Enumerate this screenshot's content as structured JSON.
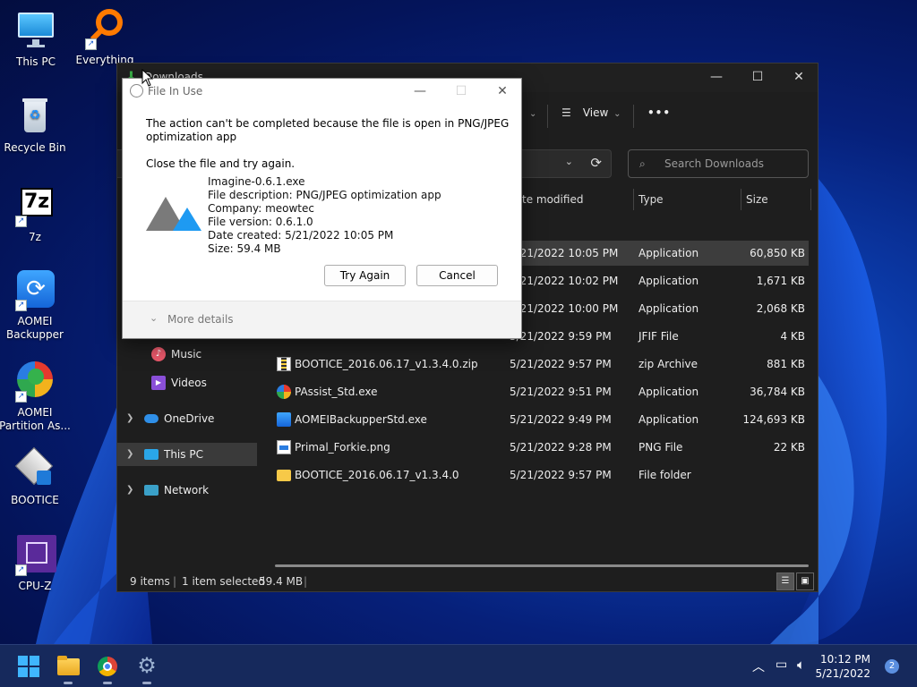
{
  "desktop": {
    "icons": [
      {
        "label": "This PC"
      },
      {
        "label": "Everything"
      },
      {
        "label": "Recycle Bin"
      },
      {
        "label": "7z"
      },
      {
        "label": "AOMEI Backupper"
      },
      {
        "label": "AOMEI Partition As..."
      },
      {
        "label": "BOOTICE"
      },
      {
        "label": "CPU-Z"
      }
    ]
  },
  "explorer": {
    "title": "Downloads",
    "toolbar": {
      "view_label": "View",
      "more_label": "•••"
    },
    "search_placeholder": "Search Downloads",
    "columns": {
      "date": "te modified",
      "type": "Type",
      "size": "Size"
    },
    "nav": [
      {
        "label": "Music"
      },
      {
        "label": "Videos"
      },
      {
        "label": "OneDrive"
      },
      {
        "label": "This PC"
      },
      {
        "label": "Network"
      }
    ],
    "files": [
      {
        "name": "",
        "date": "5/21/2022 10:05 PM",
        "type": "Application",
        "size": "60,850 KB"
      },
      {
        "name": "",
        "date": "5/21/2022 10:02 PM",
        "type": "Application",
        "size": "1,671 KB"
      },
      {
        "name": "",
        "date": "5/21/2022 10:00 PM",
        "type": "Application",
        "size": "2,068 KB"
      },
      {
        "name": "",
        "date": "5/21/2022 9:59 PM",
        "type": "JFIF File",
        "size": "4 KB"
      },
      {
        "name": "BOOTICE_2016.06.17_v1.3.4.0.zip",
        "date": "5/21/2022 9:57 PM",
        "type": "zip Archive",
        "size": "881 KB"
      },
      {
        "name": "PAssist_Std.exe",
        "date": "5/21/2022 9:51 PM",
        "type": "Application",
        "size": "36,784 KB"
      },
      {
        "name": "AOMEIBackupperStd.exe",
        "date": "5/21/2022 9:49 PM",
        "type": "Application",
        "size": "124,693 KB"
      },
      {
        "name": "Primal_Forkie.png",
        "date": "5/21/2022 9:28 PM",
        "type": "PNG File",
        "size": "22 KB"
      },
      {
        "name": "BOOTICE_2016.06.17_v1.3.4.0",
        "date": "5/21/2022 9:57 PM",
        "type": "File folder",
        "size": ""
      }
    ],
    "status": {
      "items": "9 items",
      "selected": "1 item selected",
      "size": "59.4 MB"
    }
  },
  "dialog": {
    "title": "File In Use",
    "message_line1": "The action can't be completed because the file is open in PNG/JPEG",
    "message_line2": "optimization app",
    "instruction": "Close the file and try again.",
    "info": [
      "Imagine-0.6.1.exe",
      "File description: PNG/JPEG optimization app",
      "Company: meowtec",
      "File version: 0.6.1.0",
      "Date created: 5/21/2022 10:05 PM",
      "Size: 59.4 MB"
    ],
    "try_again": "Try Again",
    "cancel": "Cancel",
    "more_details": "More details"
  },
  "taskbar": {
    "time": "10:12 PM",
    "date": "5/21/2022",
    "notification_count": "2"
  }
}
